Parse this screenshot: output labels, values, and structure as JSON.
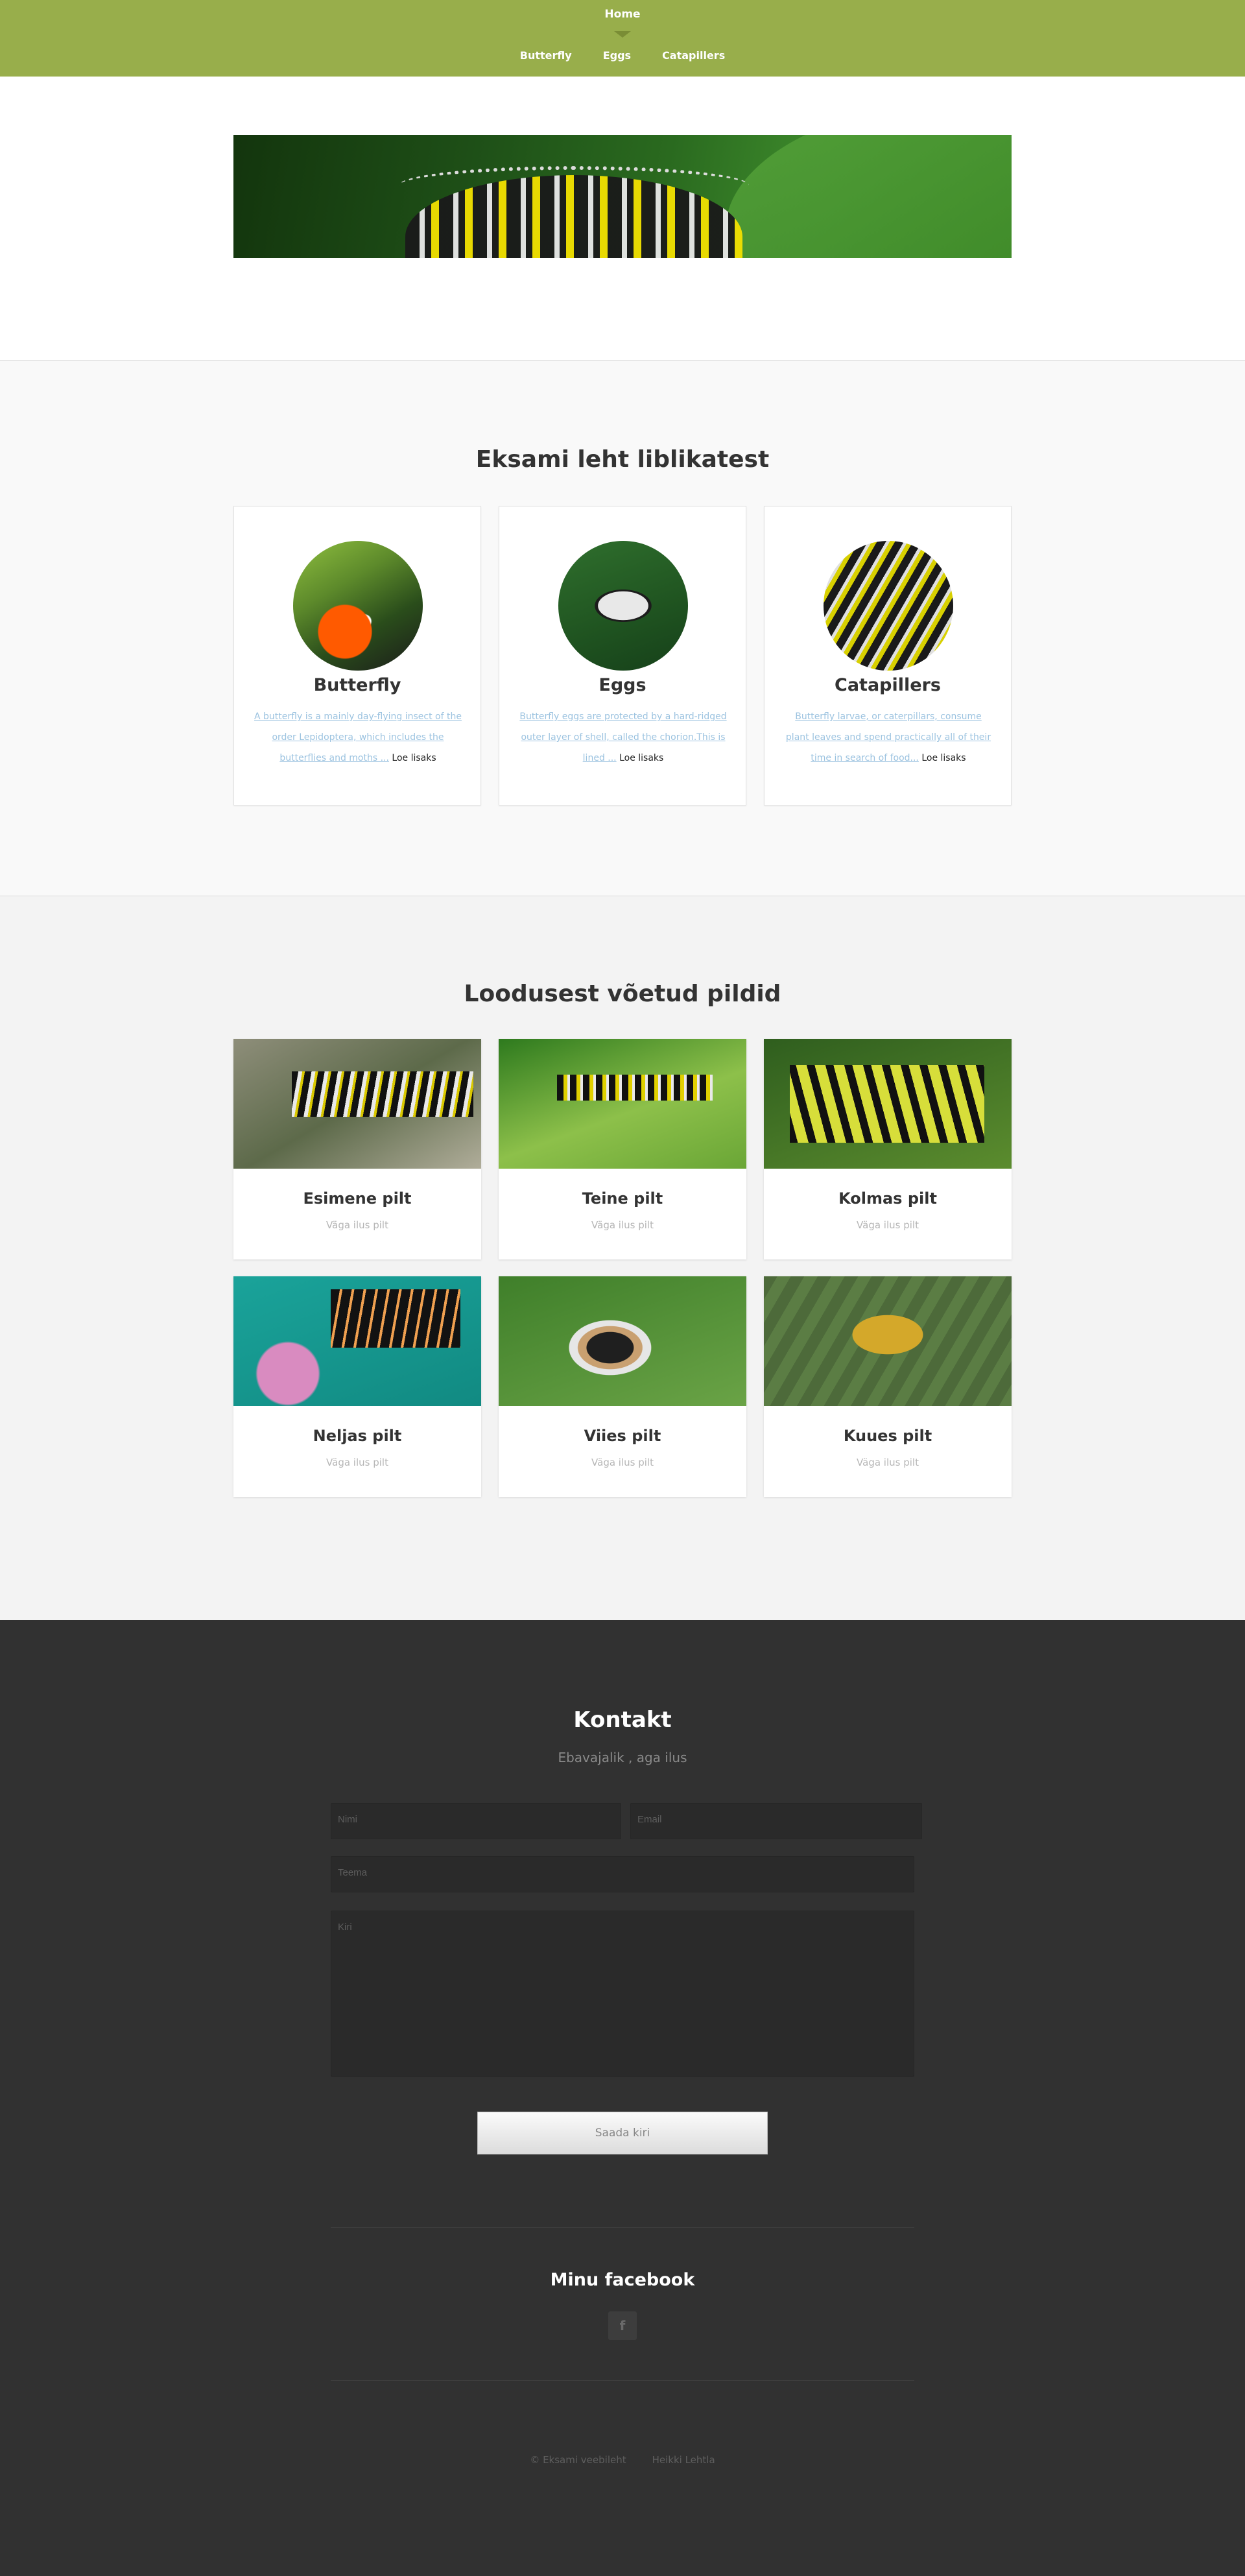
{
  "nav": {
    "home": "Home",
    "links": [
      "Butterfly",
      "Eggs",
      "Catapillers"
    ]
  },
  "section1": {
    "title": "Eksami leht liblikatest",
    "cards": [
      {
        "title": "Butterfly",
        "text": "A butterfly is a mainly day-flying insect of the order Lepidoptera, which includes the butterflies and moths ...",
        "more": "Loe lisaks"
      },
      {
        "title": "Eggs",
        "text": "Butterfly eggs are protected by a hard-ridged outer layer of shell, called the chorion.This is lined ...",
        "more": "Loe lisaks"
      },
      {
        "title": "Catapillers",
        "text": "Butterfly larvae, or caterpillars, consume plant leaves and spend practically all of their time in search of food...",
        "more": "Loe lisaks"
      }
    ]
  },
  "section2": {
    "title": "Loodusest võetud pildid",
    "photos": [
      {
        "title": "Esimene pilt",
        "caption": "Väga ilus pilt"
      },
      {
        "title": "Teine pilt",
        "caption": "Väga ilus pilt"
      },
      {
        "title": "Kolmas pilt",
        "caption": "Väga ilus pilt"
      },
      {
        "title": "Neljas pilt",
        "caption": "Väga ilus pilt"
      },
      {
        "title": "Viies pilt",
        "caption": "Väga ilus pilt"
      },
      {
        "title": "Kuues pilt",
        "caption": "Väga ilus pilt"
      }
    ]
  },
  "contact": {
    "title": "Kontakt",
    "subtitle": "Ebavajalik , aga ilus",
    "name_placeholder": "Nimi",
    "email_placeholder": "Email",
    "subject_placeholder": "Teema",
    "message_placeholder": "Kiri",
    "send_label": "Saada kiri"
  },
  "facebook": {
    "title": "Minu facebook",
    "icon": "f"
  },
  "footer": {
    "copyright": "© Eksami veebileht",
    "author": "Heikki Lehtla"
  },
  "colors": {
    "nav_bg": "#98ae4b",
    "footer_bg": "#313131",
    "link_blue": "#9cc3e0"
  }
}
